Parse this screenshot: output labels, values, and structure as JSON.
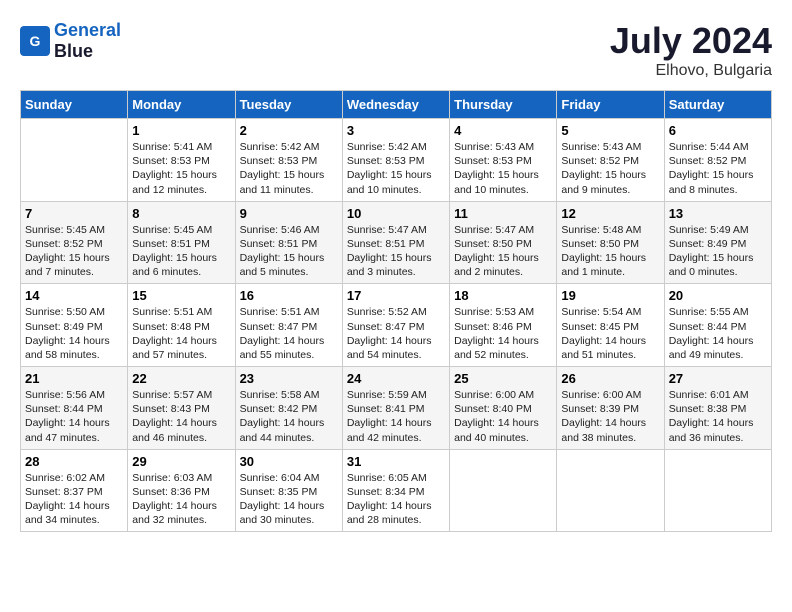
{
  "header": {
    "logo_line1": "General",
    "logo_line2": "Blue",
    "month": "July 2024",
    "location": "Elhovo, Bulgaria"
  },
  "days_of_week": [
    "Sunday",
    "Monday",
    "Tuesday",
    "Wednesday",
    "Thursday",
    "Friday",
    "Saturday"
  ],
  "weeks": [
    [
      {
        "day": "",
        "info": ""
      },
      {
        "day": "1",
        "info": "Sunrise: 5:41 AM\nSunset: 8:53 PM\nDaylight: 15 hours\nand 12 minutes."
      },
      {
        "day": "2",
        "info": "Sunrise: 5:42 AM\nSunset: 8:53 PM\nDaylight: 15 hours\nand 11 minutes."
      },
      {
        "day": "3",
        "info": "Sunrise: 5:42 AM\nSunset: 8:53 PM\nDaylight: 15 hours\nand 10 minutes."
      },
      {
        "day": "4",
        "info": "Sunrise: 5:43 AM\nSunset: 8:53 PM\nDaylight: 15 hours\nand 10 minutes."
      },
      {
        "day": "5",
        "info": "Sunrise: 5:43 AM\nSunset: 8:52 PM\nDaylight: 15 hours\nand 9 minutes."
      },
      {
        "day": "6",
        "info": "Sunrise: 5:44 AM\nSunset: 8:52 PM\nDaylight: 15 hours\nand 8 minutes."
      }
    ],
    [
      {
        "day": "7",
        "info": "Sunrise: 5:45 AM\nSunset: 8:52 PM\nDaylight: 15 hours\nand 7 minutes."
      },
      {
        "day": "8",
        "info": "Sunrise: 5:45 AM\nSunset: 8:51 PM\nDaylight: 15 hours\nand 6 minutes."
      },
      {
        "day": "9",
        "info": "Sunrise: 5:46 AM\nSunset: 8:51 PM\nDaylight: 15 hours\nand 5 minutes."
      },
      {
        "day": "10",
        "info": "Sunrise: 5:47 AM\nSunset: 8:51 PM\nDaylight: 15 hours\nand 3 minutes."
      },
      {
        "day": "11",
        "info": "Sunrise: 5:47 AM\nSunset: 8:50 PM\nDaylight: 15 hours\nand 2 minutes."
      },
      {
        "day": "12",
        "info": "Sunrise: 5:48 AM\nSunset: 8:50 PM\nDaylight: 15 hours\nand 1 minute."
      },
      {
        "day": "13",
        "info": "Sunrise: 5:49 AM\nSunset: 8:49 PM\nDaylight: 15 hours\nand 0 minutes."
      }
    ],
    [
      {
        "day": "14",
        "info": "Sunrise: 5:50 AM\nSunset: 8:49 PM\nDaylight: 14 hours\nand 58 minutes."
      },
      {
        "day": "15",
        "info": "Sunrise: 5:51 AM\nSunset: 8:48 PM\nDaylight: 14 hours\nand 57 minutes."
      },
      {
        "day": "16",
        "info": "Sunrise: 5:51 AM\nSunset: 8:47 PM\nDaylight: 14 hours\nand 55 minutes."
      },
      {
        "day": "17",
        "info": "Sunrise: 5:52 AM\nSunset: 8:47 PM\nDaylight: 14 hours\nand 54 minutes."
      },
      {
        "day": "18",
        "info": "Sunrise: 5:53 AM\nSunset: 8:46 PM\nDaylight: 14 hours\nand 52 minutes."
      },
      {
        "day": "19",
        "info": "Sunrise: 5:54 AM\nSunset: 8:45 PM\nDaylight: 14 hours\nand 51 minutes."
      },
      {
        "day": "20",
        "info": "Sunrise: 5:55 AM\nSunset: 8:44 PM\nDaylight: 14 hours\nand 49 minutes."
      }
    ],
    [
      {
        "day": "21",
        "info": "Sunrise: 5:56 AM\nSunset: 8:44 PM\nDaylight: 14 hours\nand 47 minutes."
      },
      {
        "day": "22",
        "info": "Sunrise: 5:57 AM\nSunset: 8:43 PM\nDaylight: 14 hours\nand 46 minutes."
      },
      {
        "day": "23",
        "info": "Sunrise: 5:58 AM\nSunset: 8:42 PM\nDaylight: 14 hours\nand 44 minutes."
      },
      {
        "day": "24",
        "info": "Sunrise: 5:59 AM\nSunset: 8:41 PM\nDaylight: 14 hours\nand 42 minutes."
      },
      {
        "day": "25",
        "info": "Sunrise: 6:00 AM\nSunset: 8:40 PM\nDaylight: 14 hours\nand 40 minutes."
      },
      {
        "day": "26",
        "info": "Sunrise: 6:00 AM\nSunset: 8:39 PM\nDaylight: 14 hours\nand 38 minutes."
      },
      {
        "day": "27",
        "info": "Sunrise: 6:01 AM\nSunset: 8:38 PM\nDaylight: 14 hours\nand 36 minutes."
      }
    ],
    [
      {
        "day": "28",
        "info": "Sunrise: 6:02 AM\nSunset: 8:37 PM\nDaylight: 14 hours\nand 34 minutes."
      },
      {
        "day": "29",
        "info": "Sunrise: 6:03 AM\nSunset: 8:36 PM\nDaylight: 14 hours\nand 32 minutes."
      },
      {
        "day": "30",
        "info": "Sunrise: 6:04 AM\nSunset: 8:35 PM\nDaylight: 14 hours\nand 30 minutes."
      },
      {
        "day": "31",
        "info": "Sunrise: 6:05 AM\nSunset: 8:34 PM\nDaylight: 14 hours\nand 28 minutes."
      },
      {
        "day": "",
        "info": ""
      },
      {
        "day": "",
        "info": ""
      },
      {
        "day": "",
        "info": ""
      }
    ]
  ]
}
